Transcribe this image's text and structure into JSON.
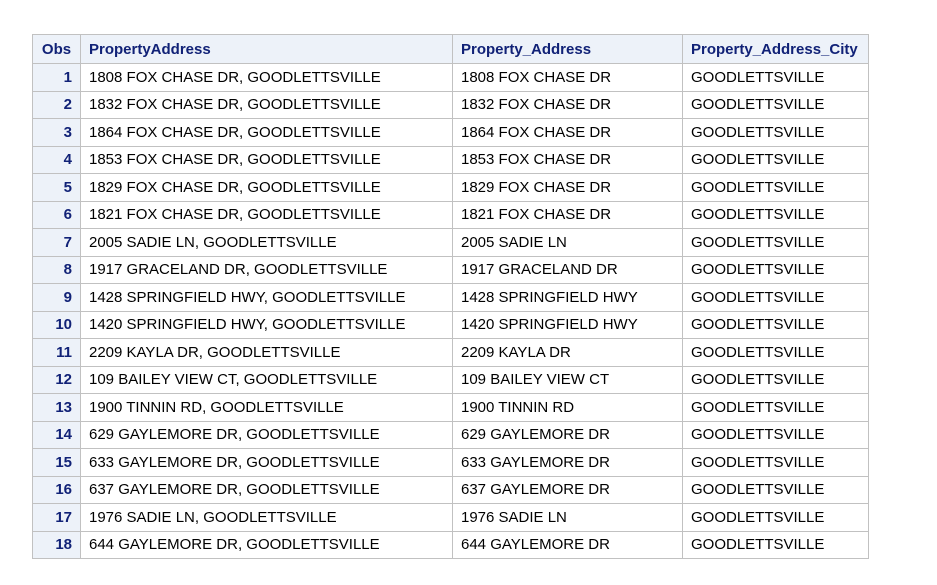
{
  "table": {
    "columns": [
      "Obs",
      "PropertyAddress",
      "Property_Address",
      "Property_Address_City"
    ],
    "rows": [
      {
        "obs": "1",
        "full": "1808 FOX CHASE DR, GOODLETTSVILLE",
        "address": "1808 FOX CHASE DR",
        "city": "GOODLETTSVILLE"
      },
      {
        "obs": "2",
        "full": "1832 FOX CHASE DR, GOODLETTSVILLE",
        "address": "1832 FOX CHASE DR",
        "city": "GOODLETTSVILLE"
      },
      {
        "obs": "3",
        "full": "1864 FOX CHASE DR, GOODLETTSVILLE",
        "address": "1864 FOX CHASE DR",
        "city": "GOODLETTSVILLE"
      },
      {
        "obs": "4",
        "full": "1853 FOX CHASE DR, GOODLETTSVILLE",
        "address": "1853 FOX CHASE DR",
        "city": "GOODLETTSVILLE"
      },
      {
        "obs": "5",
        "full": "1829 FOX CHASE DR, GOODLETTSVILLE",
        "address": "1829 FOX CHASE DR",
        "city": "GOODLETTSVILLE"
      },
      {
        "obs": "6",
        "full": "1821 FOX CHASE DR, GOODLETTSVILLE",
        "address": "1821 FOX CHASE DR",
        "city": "GOODLETTSVILLE"
      },
      {
        "obs": "7",
        "full": "2005 SADIE LN, GOODLETTSVILLE",
        "address": "2005 SADIE LN",
        "city": "GOODLETTSVILLE"
      },
      {
        "obs": "8",
        "full": "1917 GRACELAND DR, GOODLETTSVILLE",
        "address": "1917 GRACELAND DR",
        "city": "GOODLETTSVILLE"
      },
      {
        "obs": "9",
        "full": "1428 SPRINGFIELD HWY, GOODLETTSVILLE",
        "address": "1428 SPRINGFIELD HWY",
        "city": "GOODLETTSVILLE"
      },
      {
        "obs": "10",
        "full": "1420 SPRINGFIELD HWY, GOODLETTSVILLE",
        "address": "1420 SPRINGFIELD HWY",
        "city": "GOODLETTSVILLE"
      },
      {
        "obs": "11",
        "full": "2209 KAYLA DR, GOODLETTSVILLE",
        "address": "2209 KAYLA DR",
        "city": "GOODLETTSVILLE"
      },
      {
        "obs": "12",
        "full": "109 BAILEY VIEW CT, GOODLETTSVILLE",
        "address": "109 BAILEY VIEW CT",
        "city": "GOODLETTSVILLE"
      },
      {
        "obs": "13",
        "full": "1900 TINNIN RD, GOODLETTSVILLE",
        "address": "1900 TINNIN RD",
        "city": "GOODLETTSVILLE"
      },
      {
        "obs": "14",
        "full": "629 GAYLEMORE DR, GOODLETTSVILLE",
        "address": "629 GAYLEMORE DR",
        "city": "GOODLETTSVILLE"
      },
      {
        "obs": "15",
        "full": "633 GAYLEMORE DR, GOODLETTSVILLE",
        "address": "633 GAYLEMORE DR",
        "city": "GOODLETTSVILLE"
      },
      {
        "obs": "16",
        "full": "637 GAYLEMORE DR, GOODLETTSVILLE",
        "address": "637 GAYLEMORE DR",
        "city": "GOODLETTSVILLE"
      },
      {
        "obs": "17",
        "full": "1976 SADIE LN, GOODLETTSVILLE",
        "address": "1976 SADIE LN",
        "city": "GOODLETTSVILLE"
      },
      {
        "obs": "18",
        "full": "644 GAYLEMORE DR, GOODLETTSVILLE",
        "address": "644 GAYLEMORE DR",
        "city": "GOODLETTSVILLE"
      }
    ]
  },
  "colors": {
    "header_bg": "#edf2f9",
    "header_text": "#112277",
    "grid_line": "#c1c1c1"
  }
}
